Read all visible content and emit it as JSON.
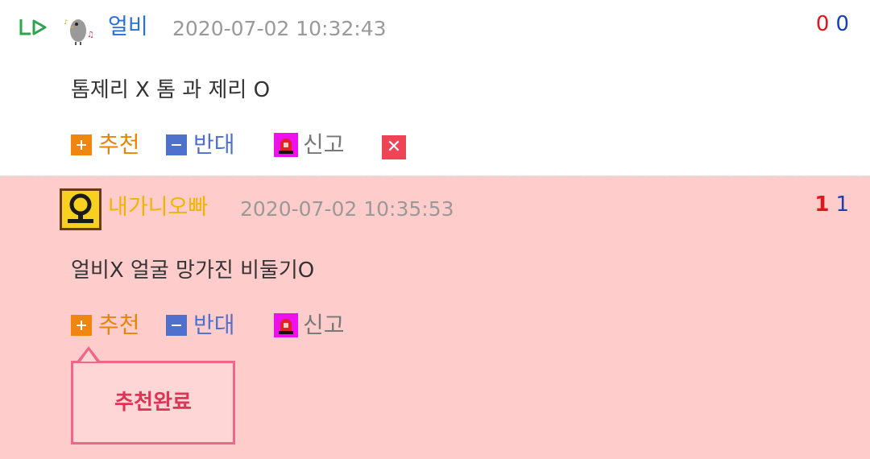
{
  "comments": [
    {
      "nickname": "얼비",
      "datetime": "2020-07-02 10:32:43",
      "upvotes": "0",
      "downvotes": "0",
      "text": "톰제리 X 톰 과 제리 O",
      "actions": {
        "recommend": "추천",
        "oppose": "반대",
        "report": "신고",
        "delete_icon": "close-icon"
      },
      "nickname_color": "#2a6fd6"
    },
    {
      "nickname": "내가니오빠",
      "datetime": "2020-07-02 10:35:53",
      "upvotes": "1",
      "downvotes": "1",
      "text": "얼비X 얼굴 망가진 비둘기O",
      "actions": {
        "recommend": "추천",
        "oppose": "반대",
        "report": "신고"
      },
      "nickname_color": "#f0b400",
      "avatar_letter": "오"
    }
  ],
  "tooltip": {
    "message": "추천완료"
  },
  "colors": {
    "recommend": "#e8840a",
    "oppose": "#4f70cc",
    "highlight_bg": "#ffcccc",
    "tooltip_border": "#ee6688"
  }
}
